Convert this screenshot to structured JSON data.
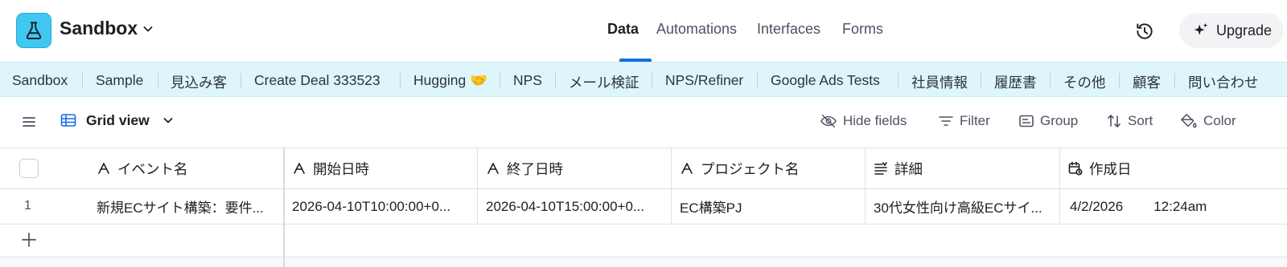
{
  "app": {
    "base_name": "Sandbox",
    "nav": [
      {
        "label": "Data",
        "active": true
      },
      {
        "label": "Automations",
        "active": false
      },
      {
        "label": "Interfaces",
        "active": false
      },
      {
        "label": "Forms",
        "active": false
      }
    ],
    "upgrade_label": "Upgrade",
    "accent_color": "#41c8f2",
    "active_underline_color": "#166ee1",
    "icons": {
      "logo": "flask-icon",
      "history": "history-icon",
      "upgrade": "sparkle-icon"
    }
  },
  "tables": [
    "Sandbox",
    "Sample",
    "見込み客",
    "Create Deal 333523",
    "Hugging 🤝",
    "NPS",
    "メール検証",
    "NPS/Refiner",
    "Google Ads Tests",
    "社員情報",
    "履歴書",
    "その他",
    "顧客",
    "問い合わせ"
  ],
  "viewbar": {
    "view_name": "Grid view",
    "hide_fields": "Hide fields",
    "filter": "Filter",
    "group": "Group",
    "sort": "Sort",
    "color": "Color"
  },
  "grid": {
    "columns": [
      {
        "name": "イベント名",
        "icon": "text-type-icon"
      },
      {
        "name": "開始日時",
        "icon": "text-type-icon"
      },
      {
        "name": "終了日時",
        "icon": "text-type-icon"
      },
      {
        "name": "プロジェクト名",
        "icon": "text-type-icon"
      },
      {
        "name": "詳細",
        "icon": "long-text-icon"
      },
      {
        "name": "作成日",
        "icon": "created-time-icon"
      }
    ],
    "rows": [
      {
        "number": "1",
        "cells": [
          "新規ECサイト構築：要件...",
          "2026-04-10T10:00:00+0...",
          "2026-04-10T15:00:00+0...",
          "EC構築PJ",
          "30代女性向け高級ECサイ...",
          "4/2/2026"
        ],
        "created_time": "12:24am"
      }
    ]
  }
}
